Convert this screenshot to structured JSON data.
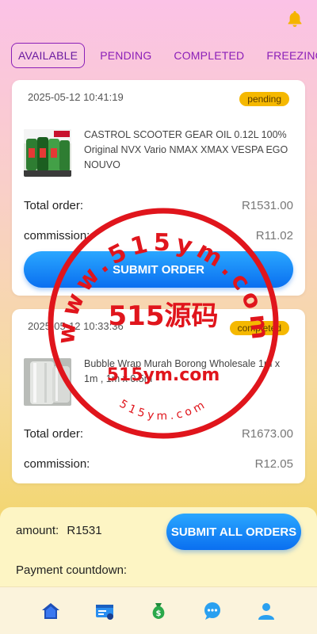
{
  "header": {
    "notification_icon": "bell-icon"
  },
  "tabs": [
    {
      "label": "AVAILABLE",
      "active": true
    },
    {
      "label": "PENDING",
      "active": false
    },
    {
      "label": "COMPLETED",
      "active": false
    },
    {
      "label": "FREEZING",
      "active": false
    }
  ],
  "orders": [
    {
      "time": "2025-05-12 10:41:19",
      "status": "pending",
      "product": "CASTROL SCOOTER GEAR OIL 0.12L 100% Original NVX Vario NMAX XMAX VESPA EGO NOUVO",
      "total_label": "Total order:",
      "total_value": "R1531.00",
      "commission_label": "commission:",
      "commission_value": "R11.02",
      "button_label": "SUBMIT ORDER"
    },
    {
      "time": "2025-05-12 10:33:36",
      "status": "completed",
      "product": "Bubble Wrap Murah Borong Wholesale 1m x 1m , 1m x 0.5m",
      "total_label": "Total order:",
      "total_value": "R1673.00",
      "commission_label": "commission:",
      "commission_value": "R12.05"
    }
  ],
  "footer": {
    "amount_label": "amount:",
    "amount_value": "R1531",
    "submit_all_label": "SUBMIT ALL ORDERS",
    "countdown_label": "Payment countdown:"
  },
  "watermark": {
    "top_text": "www.515ym.com",
    "center_text": "515源码",
    "middle_text": "515ym.com",
    "bottom_text": "515ym.com"
  },
  "nav": [
    {
      "icon": "home-icon",
      "active": true
    },
    {
      "icon": "orders-icon",
      "active": false
    },
    {
      "icon": "money-bag-icon",
      "active": false
    },
    {
      "icon": "chat-icon",
      "active": false
    },
    {
      "icon": "profile-icon",
      "active": false
    }
  ],
  "colors": {
    "accent_purple": "#8b1fb8",
    "button_blue": "#0a6ff0",
    "badge_yellow": "#f5b800",
    "stamp_red": "#e0151c"
  }
}
